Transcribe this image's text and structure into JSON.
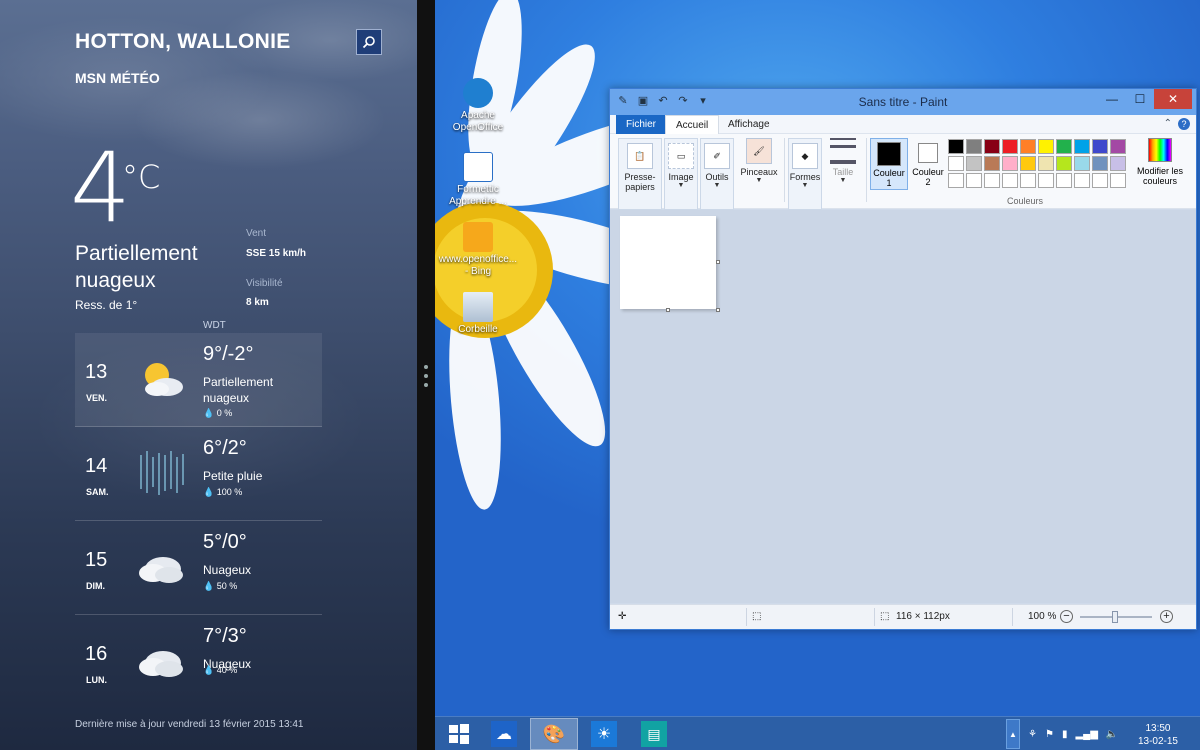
{
  "weather": {
    "city": "HOTTON, WALLONIE",
    "source": "MSN MÉTÉO",
    "temp": "4",
    "unit": "°C",
    "condition": "Partiellement nuageux",
    "feels_like": "Ress. de 1°",
    "wind_label": "Vent",
    "wind_value": "SSE 15 km/h",
    "visibility_label": "Visibilité",
    "visibility_value": "8 km",
    "provider": "WDT",
    "forecast": [
      {
        "day": "13",
        "name": "VEN.",
        "temps": "9°/-2°",
        "desc": "Partiellement nuageux",
        "precip": "0 %",
        "icon": "partly-cloudy-icon"
      },
      {
        "day": "14",
        "name": "SAM.",
        "temps": "6°/2°",
        "desc": "Petite pluie",
        "precip": "100 %",
        "icon": "rain-icon"
      },
      {
        "day": "15",
        "name": "DIM.",
        "temps": "5°/0°",
        "desc": "Nuageux",
        "precip": "50 %",
        "icon": "cloud-icon"
      },
      {
        "day": "16",
        "name": "LUN.",
        "temps": "7°/3°",
        "desc": "Nuageux",
        "precip": "40 %",
        "icon": "cloud-icon"
      }
    ],
    "updated": "Dernière mise à jour vendredi 13 février 2015 13:41"
  },
  "desktop": {
    "icons": [
      {
        "label": "Apache OpenOffice"
      },
      {
        "label": "Formettic Apprendre ..."
      },
      {
        "label": "www.openoffice... - Bing"
      },
      {
        "label": "Corbeille"
      }
    ]
  },
  "paint": {
    "title": "Sans titre - Paint",
    "tabs": {
      "file": "Fichier",
      "home": "Accueil",
      "view": "Affichage"
    },
    "groups": {
      "clipboard": "Presse-papiers",
      "image": "Image",
      "tools": "Outils",
      "brushes": "Pinceaux",
      "shapes": "Formes",
      "size": "Taille",
      "color1": "Couleur 1",
      "color2": "Couleur 2",
      "edit_colors": "Modifier les couleurs",
      "colors": "Couleurs"
    },
    "palette": [
      "#000000",
      "#7f7f7f",
      "#880015",
      "#ed1c24",
      "#ff7f27",
      "#fff200",
      "#22b14c",
      "#00a2e8",
      "#3f48cc",
      "#a349a4",
      "#ffffff",
      "#c3c3c3",
      "#b97a57",
      "#ffaec9",
      "#ffc90e",
      "#efe4b0",
      "#b5e61d",
      "#99d9ea",
      "#7092be",
      "#c8bfe7",
      "#ffffff",
      "#ffffff",
      "#ffffff",
      "#ffffff",
      "#ffffff",
      "#ffffff",
      "#ffffff",
      "#ffffff",
      "#ffffff",
      "#ffffff"
    ],
    "status": {
      "dimensions": "116 × 112px",
      "zoom": "100 %"
    }
  },
  "taskbar": {
    "clock_time": "13:50",
    "clock_date": "13-02-15"
  }
}
